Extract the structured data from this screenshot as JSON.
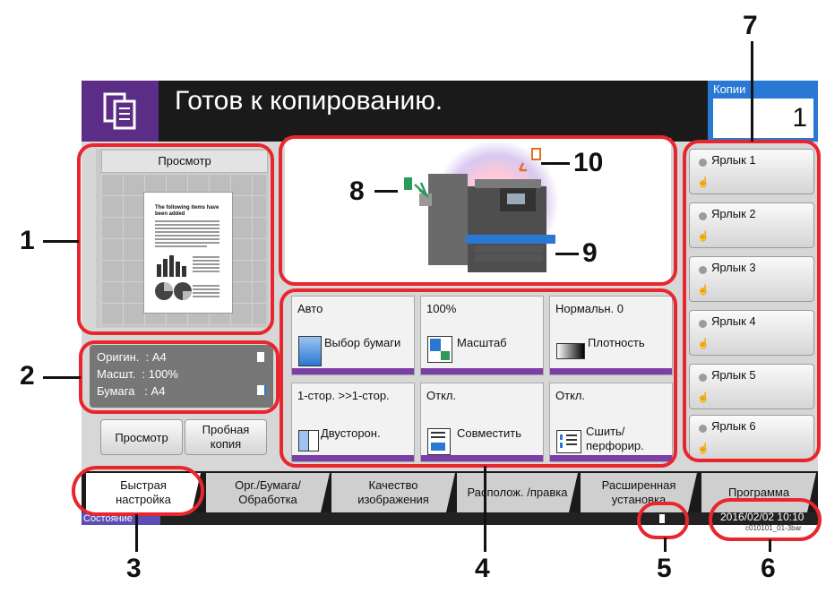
{
  "header": {
    "title": "Готов к копированию.",
    "copies_label": "Копии",
    "copies_value": "1"
  },
  "preview": {
    "heading": "Просмотр",
    "doc_title": "The following items have been added",
    "info": [
      {
        "label": "Оригин.",
        "value": ": A4"
      },
      {
        "label": "Масшт.",
        "value": ": 100%"
      },
      {
        "label": "Бумага",
        "value": ": A4"
      }
    ],
    "btn_preview": "Просмотр",
    "btn_sample": "Пробная копия"
  },
  "functions": [
    {
      "value": "Авто",
      "label": "Выбор бумаги",
      "icon": "paper-tray-icon"
    },
    {
      "value": "100%",
      "label": "Масштаб",
      "icon": "zoom-icon"
    },
    {
      "value": "Нормальн. 0",
      "label": "Плотность",
      "icon": "density-gradient-icon"
    },
    {
      "value": "1-стор. >>1-стор.",
      "label": "Двусторон.",
      "icon": "duplex-icon"
    },
    {
      "value": "Откл.",
      "label": "Совместить",
      "icon": "combine-icon"
    },
    {
      "value": "Откл.",
      "label": "Сшить/ перфорир.",
      "icon": "staple-icon"
    }
  ],
  "shortcuts": [
    "Ярлык 1",
    "Ярлык 2",
    "Ярлык 3",
    "Ярлык 4",
    "Ярлык 5",
    "Ярлык 6"
  ],
  "tabs": [
    "Быстрая настройка",
    "Орг./Бумага/ Обработка",
    "Качество изображения",
    "Располож. /правка",
    "Расширенная установка",
    "Программа"
  ],
  "status": {
    "label": "Состояние",
    "datetime": "2016/02/02  10:10",
    "code": "c010101_01-3bar"
  },
  "callouts": [
    "1",
    "2",
    "3",
    "4",
    "5",
    "6",
    "7",
    "8",
    "9",
    "10"
  ],
  "colors": {
    "accent_purple": "#5c2d86",
    "copies_blue": "#2878d4",
    "callout_red": "#e8262e",
    "bar_purple": "#7b3fa6"
  }
}
